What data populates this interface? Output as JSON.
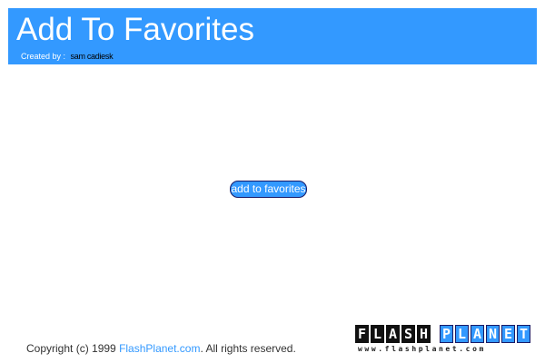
{
  "header": {
    "title": "Add To Favorites",
    "created_by_label": "Created by :",
    "creator_name": "sam cadiesk"
  },
  "main": {
    "favorites_button_label": "add to favorites"
  },
  "footer": {
    "copyright_prefix": "Copyright (c) 1999",
    "copyright_link": "FlashPlanet.com",
    "copyright_suffix": ". All rights reserved."
  },
  "logo": {
    "word_flash": "FLASH",
    "word_planet": "PLANET",
    "url": "www.flashplanet.com"
  },
  "colors": {
    "accent": "#3399ff",
    "background": "#ffffff",
    "text": "#333333"
  }
}
